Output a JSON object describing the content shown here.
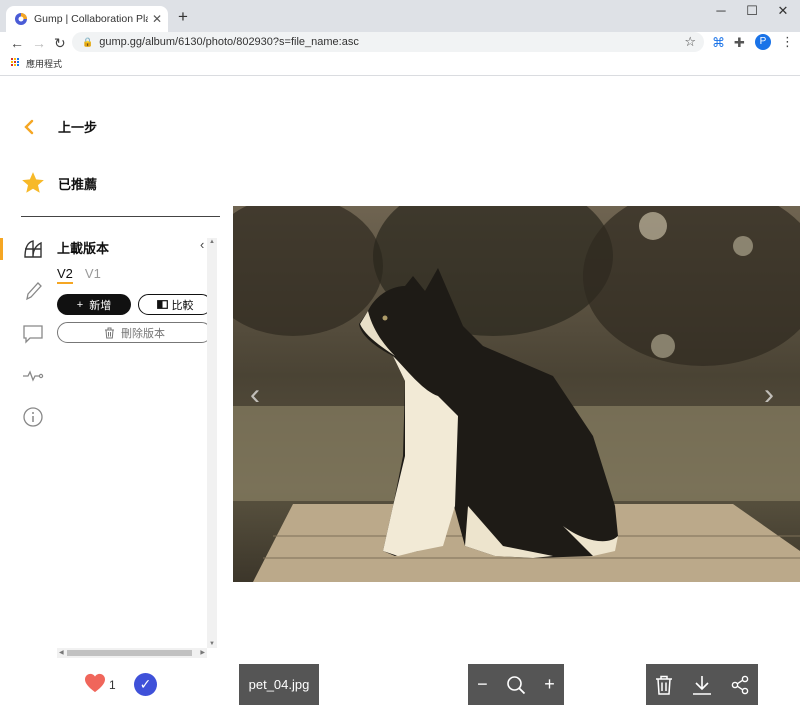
{
  "browser": {
    "tab_title": "Gump | Collaboration Platform",
    "tab_close": "✕",
    "new_tab": "+",
    "url": "gump.gg/album/6130/photo/802930?s=file_name:asc",
    "bookmarks_apps_label": "應用程式",
    "profile_initial": "P",
    "window_controls": [
      "─",
      "☐",
      "✕"
    ]
  },
  "sidebar": {
    "back_label": "上一步",
    "recommended_label": "已推薦",
    "version_title": "上載版本",
    "versions": [
      "V2",
      "V1"
    ],
    "active_version": "V2",
    "add_button": "新增",
    "compare_button": "比較",
    "delete_version_button": "刪除版本",
    "side_icons": [
      "versions-icon",
      "pencil-icon",
      "comment-icon",
      "activity-icon",
      "info-icon"
    ]
  },
  "footer": {
    "like_count": "1",
    "file_name": "pet_04.jpg",
    "zoom_out": "−",
    "zoom_in": "+"
  },
  "colors": {
    "accent": "#f5a623",
    "heart": "#f0665b",
    "approve": "#3f51d9",
    "toolbar_bg": "#555555"
  }
}
